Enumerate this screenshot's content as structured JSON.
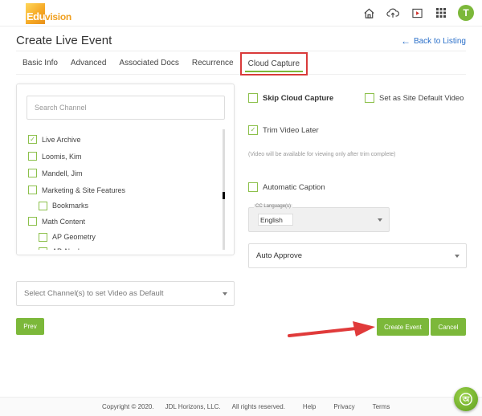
{
  "header": {
    "logo_prefix": "Edu",
    "logo_suffix": "vision",
    "icons": [
      "home-icon",
      "cloud-upload-icon",
      "video-play-icon",
      "apps-grid-icon"
    ],
    "avatar_initial": "T",
    "accent_color": "#7cb83a"
  },
  "page": {
    "title": "Create Live Event",
    "back_link": "Back to Listing"
  },
  "tabs": [
    {
      "label": "Basic Info",
      "active": false
    },
    {
      "label": "Advanced",
      "active": false
    },
    {
      "label": "Associated Docs",
      "active": false
    },
    {
      "label": "Recurrence",
      "active": false
    },
    {
      "label": "Cloud Capture",
      "active": true
    }
  ],
  "channels": {
    "search_placeholder": "Search Channel",
    "items": [
      {
        "label": "Live Archive",
        "checked": true,
        "sub": false
      },
      {
        "label": "Loomis, Kim",
        "checked": false,
        "sub": false
      },
      {
        "label": "Mandell, Jim",
        "checked": false,
        "sub": false
      },
      {
        "label": "Marketing & Site Features",
        "checked": false,
        "sub": false
      },
      {
        "label": "Bookmarks",
        "checked": false,
        "sub": true
      },
      {
        "label": "Math Content",
        "checked": false,
        "sub": false
      },
      {
        "label": "AP Geometry",
        "checked": false,
        "sub": true
      },
      {
        "label": "AP Algebra",
        "checked": false,
        "sub": true
      }
    ]
  },
  "options": {
    "skip_cloud_capture": {
      "label": "Skip Cloud Capture",
      "checked": false
    },
    "site_default_video": {
      "label": "Set as Site Default Video",
      "checked": false
    },
    "trim_video_later": {
      "label": "Trim Video Later",
      "checked": true
    },
    "trim_note": "(Video will be available for viewing only after trim complete)",
    "automatic_caption": {
      "label": "Automatic Caption",
      "checked": false
    },
    "cc_language_label": "CC Language(s)",
    "cc_language_value": "English",
    "approval_value": "Auto Approve"
  },
  "default_channel_select": {
    "placeholder": "Select Channel(s) to set Video as Default"
  },
  "buttons": {
    "prev": "Prev",
    "create_event": "Create Event",
    "cancel": "Cancel"
  },
  "footer": {
    "copyright": "Copyright © 2020.",
    "company": "JDL Horizons, LLC.",
    "rights": "All rights reserved.",
    "links": [
      "Help",
      "Privacy",
      "Terms"
    ]
  }
}
